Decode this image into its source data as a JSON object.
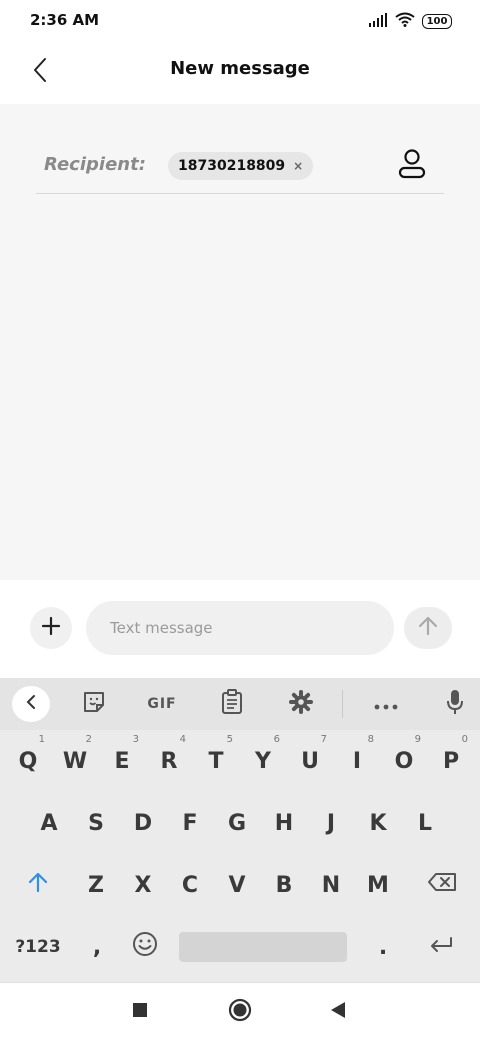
{
  "status_bar": {
    "time": "2:36 AM",
    "battery": "100"
  },
  "header": {
    "title": "New message"
  },
  "recipient": {
    "label": "Recipient:",
    "chip": "18730218809",
    "chip_remove": "×"
  },
  "compose": {
    "placeholder": "Text message"
  },
  "keyboard": {
    "toolbar": {
      "gif_label": "GIF"
    },
    "row1": [
      {
        "key": "Q",
        "hint": "1"
      },
      {
        "key": "W",
        "hint": "2"
      },
      {
        "key": "E",
        "hint": "3"
      },
      {
        "key": "R",
        "hint": "4"
      },
      {
        "key": "T",
        "hint": "5"
      },
      {
        "key": "Y",
        "hint": "6"
      },
      {
        "key": "U",
        "hint": "7"
      },
      {
        "key": "I",
        "hint": "8"
      },
      {
        "key": "O",
        "hint": "9"
      },
      {
        "key": "P",
        "hint": "0"
      }
    ],
    "row2": [
      "A",
      "S",
      "D",
      "F",
      "G",
      "H",
      "J",
      "K",
      "L"
    ],
    "row3": [
      "Z",
      "X",
      "C",
      "V",
      "B",
      "N",
      "M"
    ],
    "row4": {
      "symbols": "?123",
      "comma": ",",
      "period": "."
    }
  },
  "colors": {
    "shift_accent": "#2d8fe6",
    "content_bg": "#f6f6f6",
    "keyboard_bg": "#ebebeb"
  }
}
